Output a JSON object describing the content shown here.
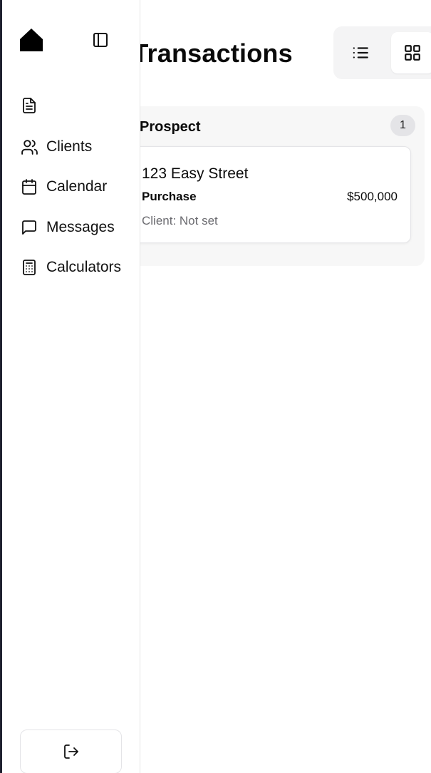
{
  "page": {
    "title": "Your Transactions"
  },
  "view_toggle": {
    "list_icon": "list-icon",
    "grid_icon": "grid-icon",
    "active": "grid"
  },
  "board": {
    "columns": [
      {
        "title": "Prospect",
        "count": "1",
        "cards": [
          {
            "address": "123 Easy Street",
            "type": "Purchase",
            "price": "$500,000",
            "client": "Client: Not set"
          }
        ]
      }
    ]
  },
  "sidebar": {
    "logo_icon": "home-icon",
    "collapse_icon": "sidebar-toggle-icon",
    "items": [
      {
        "label": "",
        "icon": "document-icon"
      },
      {
        "label": "Clients",
        "icon": "users-icon"
      },
      {
        "label": "Calendar",
        "icon": "calendar-icon"
      },
      {
        "label": "Messages",
        "icon": "message-icon"
      },
      {
        "label": "Calculators",
        "icon": "calculator-icon"
      }
    ],
    "logout_icon": "logout-icon"
  },
  "colors": {
    "left_edge": "#1f2130",
    "column_bg": "#f7f7f7",
    "badge_bg": "#e4e4e7",
    "muted_text": "#6b6b70"
  }
}
